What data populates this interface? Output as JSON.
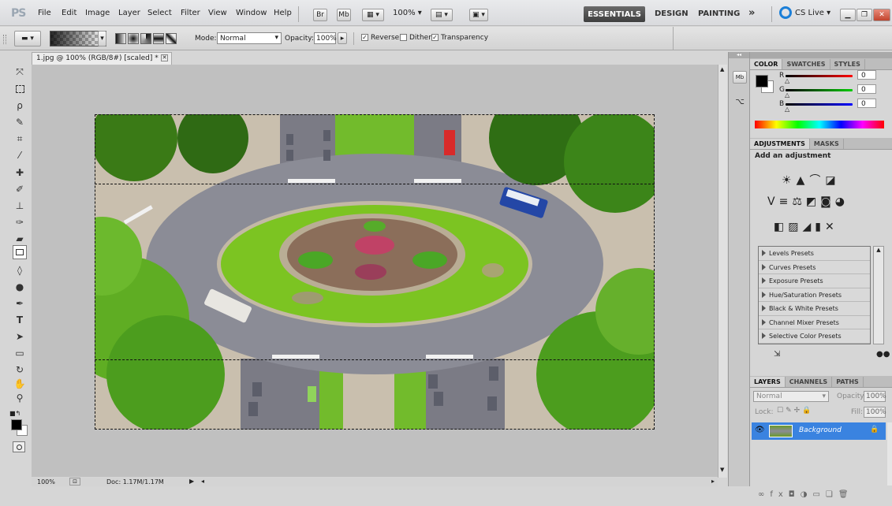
{
  "menubar": {
    "app_logo": "PS",
    "menus": [
      "File",
      "Edit",
      "Image",
      "Layer",
      "Select",
      "Filter",
      "View",
      "Window",
      "Help"
    ],
    "btn_br": "Br",
    "btn_mb": "Mb",
    "zoom_value": "100%",
    "workspaces": {
      "essentials": "ESSENTIALS",
      "design": "DESIGN",
      "painting": "PAINTING",
      "more": "»"
    },
    "cslive": "CS Live"
  },
  "optionsbar": {
    "mode_label": "Mode:",
    "mode_value": "Normal",
    "opacity_label": "Opacity:",
    "opacity_value": "100%",
    "reverse_label": "Reverse",
    "dither_label": "Dither",
    "transparency_label": "Transparency"
  },
  "document": {
    "tab_title": "1.jpg @ 100% (RGB/8#) [scaled] *",
    "status_zoom": "100%",
    "status_doc": "Doc: 1.17M/1.17M"
  },
  "color_panel": {
    "tabs": [
      "COLOR",
      "SWATCHES",
      "STYLES"
    ],
    "r_label": "R",
    "g_label": "G",
    "b_label": "B",
    "r_value": "0",
    "g_value": "0",
    "b_value": "0"
  },
  "adjustments_panel": {
    "tabs": [
      "ADJUSTMENTS",
      "MASKS"
    ],
    "heading": "Add an adjustment",
    "presets": [
      "Levels Presets",
      "Curves Presets",
      "Exposure Presets",
      "Hue/Saturation Presets",
      "Black & White Presets",
      "Channel Mixer Presets",
      "Selective Color Presets"
    ]
  },
  "layers_panel": {
    "tabs": [
      "LAYERS",
      "CHANNELS",
      "PATHS"
    ],
    "blend_mode": "Normal",
    "opacity_label": "Opacity:",
    "opacity_value": "100%",
    "lock_label": "Lock:",
    "fill_label": "Fill:",
    "fill_value": "100%",
    "layer_name": "Background"
  },
  "colors": {
    "layer_highlight": "#3a83e0",
    "essentials_bg": "#4a4a4a",
    "canvas_bg": "#c0c0c0"
  }
}
